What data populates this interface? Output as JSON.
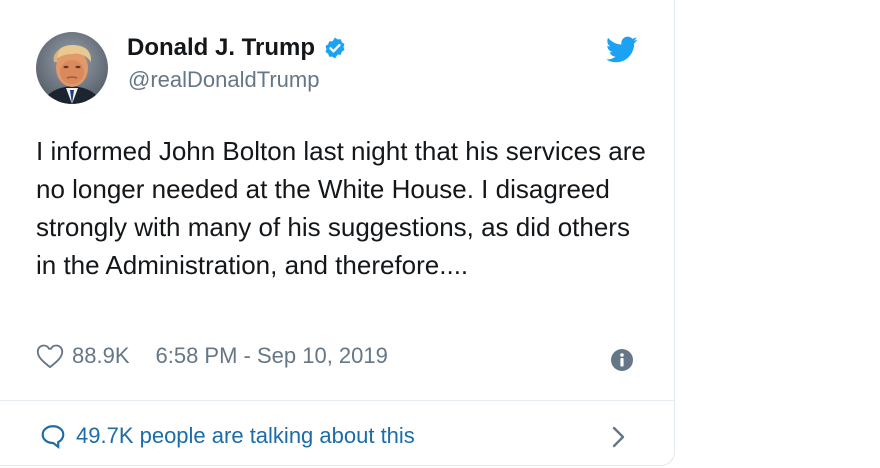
{
  "tweet": {
    "display_name": "Donald J. Trump",
    "handle": "@realDonaldTrump",
    "text": "I informed John Bolton last night that his services are no longer needed at the White House. I disagreed strongly with many of his suggestions, as did others in the Administration, and therefore....",
    "likes": "88.9K",
    "timestamp": "6:58 PM - Sep 10, 2019",
    "talking": "49.7K people are talking about this"
  },
  "colors": {
    "twitter_blue": "#1da1f2",
    "link_blue": "#1b6ca8",
    "text": "#14171a",
    "muted": "#657786"
  },
  "icons": [
    "verified-badge-icon",
    "twitter-bird-icon",
    "heart-icon",
    "info-icon",
    "speech-bubble-icon",
    "chevron-right-icon"
  ]
}
